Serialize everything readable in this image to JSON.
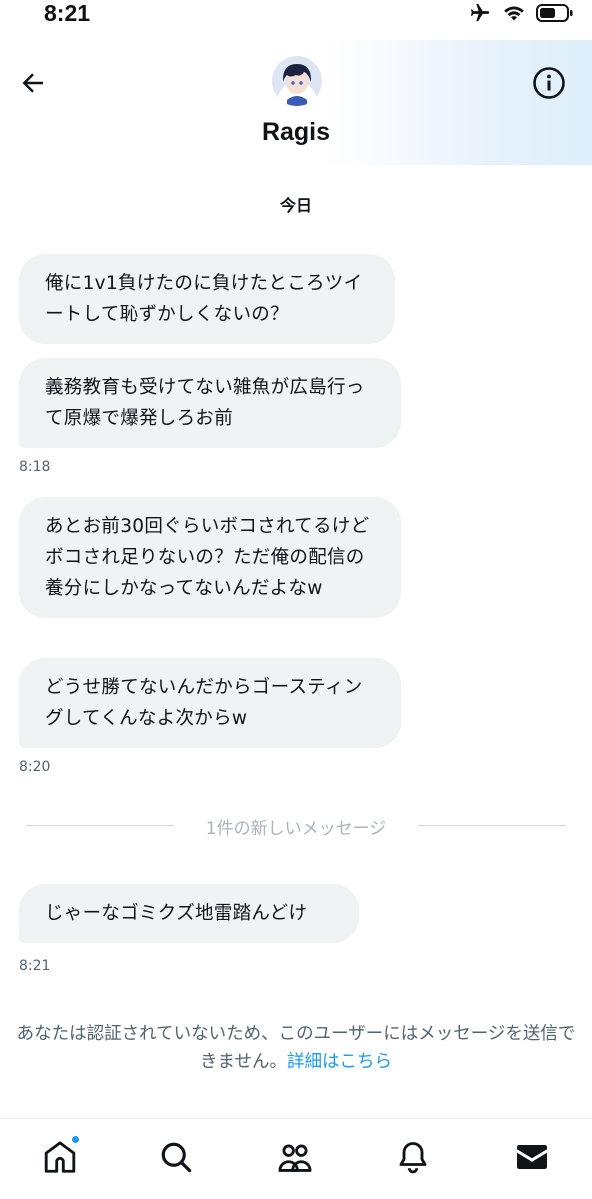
{
  "status_bar": {
    "time": "8:21",
    "icons": [
      "airplane-icon",
      "wifi-icon",
      "battery-icon"
    ]
  },
  "header": {
    "name": "Ragis",
    "back_icon": "back-arrow-icon",
    "info_icon": "info-icon"
  },
  "conversation": {
    "date_label": "今日",
    "messages": [
      {
        "text": "俺に1v1負けたのに負けたところツイートして恥ずかしくないの？"
      },
      {
        "text": "義務教育も受けてない雑魚が広島行って原爆で爆発しろお前"
      },
      {
        "text": "あとお前30回ぐらいボコされてるけどボコされ足りないの？ただ俺の配信の養分にしかなってないんだよなw"
      },
      {
        "text": "どうせ勝てないんだからゴースティングしてくんなよ次からw"
      },
      {
        "text": "じゃーなゴミクズ地雷踏んどけ"
      }
    ],
    "timestamps": [
      "8:18",
      "8:20",
      "8:21"
    ],
    "new_messages_divider": "1件の新しいメッセージ"
  },
  "notice": {
    "text": "あなたは認証されていないため、このユーザーにはメッセージを送信できません。",
    "link": "詳細はこちら"
  },
  "tabbar": {
    "tabs": [
      "home-icon",
      "search-icon",
      "communities-icon",
      "notifications-icon",
      "messages-icon"
    ],
    "accent": "#1d9bf0"
  },
  "colors": {
    "bubble": "#eff3f4",
    "text": "#0f1419",
    "secondary": "#536471",
    "link": "#1d9bf0"
  }
}
